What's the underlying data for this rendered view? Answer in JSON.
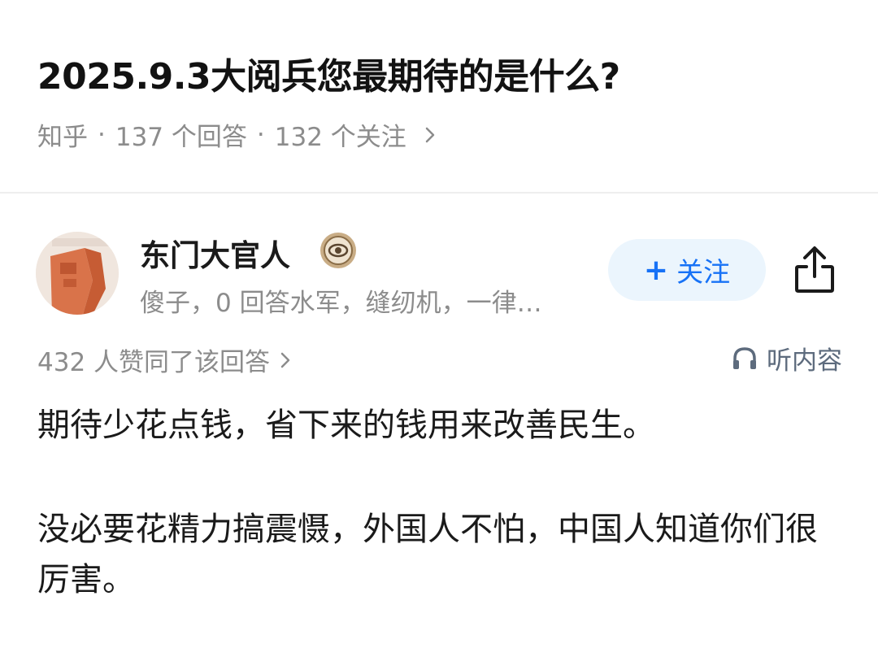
{
  "question": {
    "title": "2025.9.3大阅兵您最期待的是什么?",
    "source": "知乎",
    "separator": "·",
    "answer_count": "137 个回答",
    "follower_count": "132 个关注"
  },
  "author": {
    "name": "东门大官人",
    "bio": "傻子，0 回答水军，缝纫机，一律…",
    "follow_label": "关注"
  },
  "answer": {
    "upvotes": "432 人赞同了该回答",
    "listen_label": "听内容",
    "paragraphs": [
      "期待少花点钱，省下来的钱用来改善民生。",
      "没必要花精力搞震慑，外国人不怕，中国人知道你们很厉害。"
    ]
  },
  "icons": {
    "meta_chevron": "chevron-right-icon",
    "badge": "verified-badge-icon",
    "share": "share-icon",
    "listen": "headphones-icon"
  },
  "colors": {
    "accent": "#1772f6",
    "follow_bg": "#ebf5fd",
    "secondary_text": "#8c8c8c"
  }
}
